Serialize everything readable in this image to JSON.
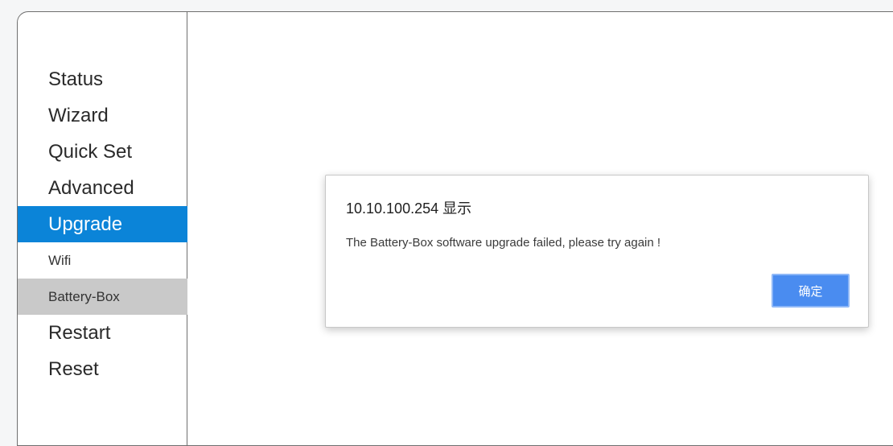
{
  "sidebar": {
    "items": [
      {
        "label": "Status"
      },
      {
        "label": "Wizard"
      },
      {
        "label": "Quick Set"
      },
      {
        "label": "Advanced"
      },
      {
        "label": "Upgrade"
      },
      {
        "label": "Wifi"
      },
      {
        "label": "Battery-Box"
      },
      {
        "label": "Restart"
      },
      {
        "label": "Reset"
      }
    ],
    "active_item": "Upgrade",
    "selected_subitem": "Battery-Box"
  },
  "dialog": {
    "title": "10.10.100.254 显示",
    "message": "The Battery-Box software upgrade failed, please try again !",
    "ok_label": "确定"
  },
  "colors": {
    "active_item_bg": "#0b84d8",
    "selected_subitem_bg": "#c9c9c9",
    "ok_button_bg": "#4a8cf0"
  }
}
